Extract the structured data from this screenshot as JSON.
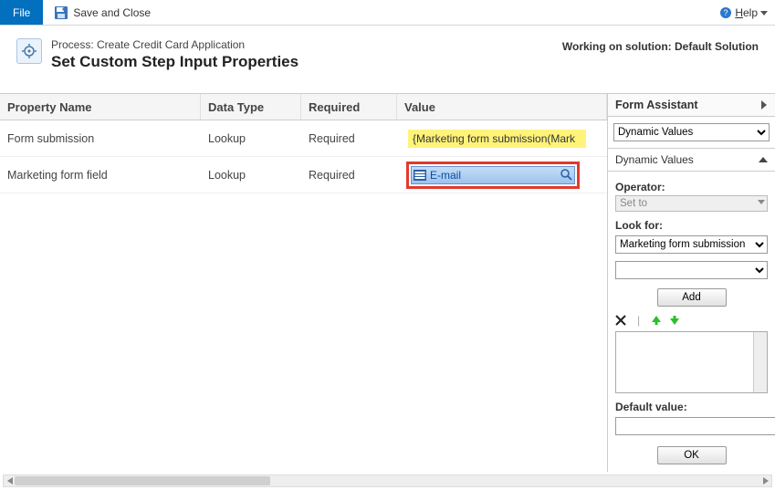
{
  "topbar": {
    "file_label": "File",
    "save_close_label": "Save and Close",
    "help_label": "Help"
  },
  "header": {
    "process_prefix": "Process: ",
    "process_name": "Create Credit Card Application",
    "page_title": "Set Custom Step Input Properties",
    "solution_prefix": "Working on solution: ",
    "solution_name": "Default Solution"
  },
  "table": {
    "columns": {
      "name": "Property Name",
      "type": "Data Type",
      "required": "Required",
      "value": "Value"
    },
    "rows": [
      {
        "name": "Form submission",
        "type": "Lookup",
        "required": "Required",
        "value_text": "{Marketing form submission(Mark"
      },
      {
        "name": "Marketing form field",
        "type": "Lookup",
        "required": "Required",
        "value_text": "E-mail"
      }
    ]
  },
  "assistant": {
    "title": "Form Assistant",
    "selector": "Dynamic Values",
    "section_title": "Dynamic Values",
    "operator_label": "Operator:",
    "operator_value": "Set to",
    "lookfor_label": "Look for:",
    "lookfor_value": "Marketing form submission",
    "lookfor_sub": "",
    "add_label": "Add",
    "default_label": "Default value:",
    "ok_label": "OK",
    "icons": {
      "remove": "remove-icon",
      "up": "move-up-icon",
      "down": "move-down-icon"
    }
  }
}
